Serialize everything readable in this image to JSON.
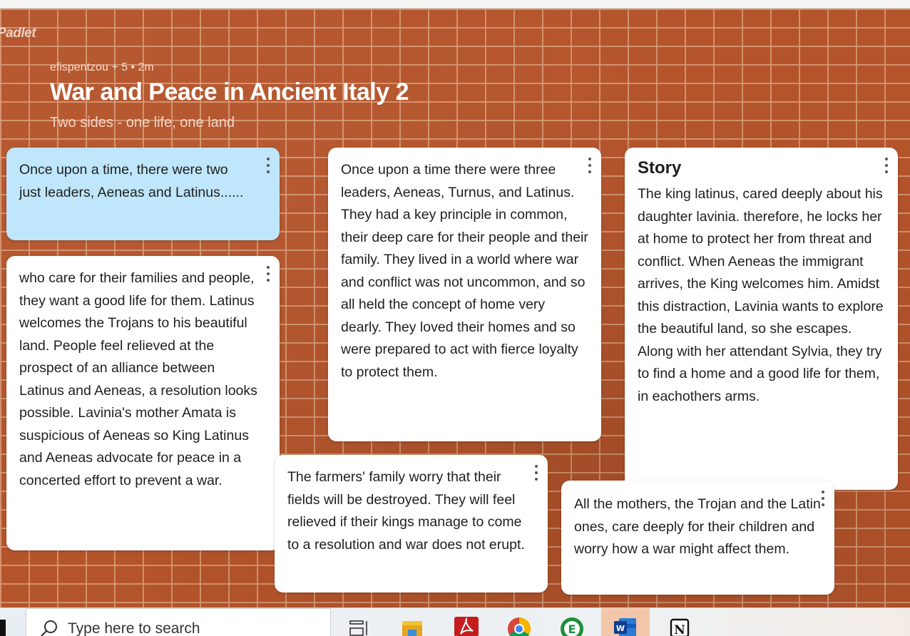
{
  "app": {
    "logo": "Padlet"
  },
  "board": {
    "meta": "efispentzou + 5 • 2m",
    "title": "War and Peace in Ancient Italy 2",
    "subtitle": "Two sides - one life, one land"
  },
  "cards": [
    {
      "heading": "",
      "body": "Once upon a time, there were two just leaders, Aeneas and Latinus......"
    },
    {
      "heading": "",
      "body": "who care for their families and people, they want a good life for them. Latinus welcomes the Trojans to his beautiful land. People feel relieved at the prospect of an alliance between Latinus and Aeneas, a resolution looks possible. Lavinia's mother Amata is suspicious of Aeneas so King Latinus and Aeneas advocate for peace in a concerted effort to prevent a war."
    },
    {
      "heading": "",
      "body": "Once upon a time there were three leaders, Aeneas, Turnus, and Latinus. They had a key principle in common, their deep care for their people and their family. They lived in a world where war and conflict was not uncommon, and so all held the concept of home very dearly. They loved their homes and so were prepared to act with fierce loyalty to protect them."
    },
    {
      "heading": "",
      "body": "The farmers' family worry that their fields will be destroyed. They will feel relieved if their kings manage to come to a resolution and war does not erupt."
    },
    {
      "heading": "Story",
      "body": "The king latinus, cared deeply about his daughter lavinia. therefore, he locks her at home to protect her from threat and conflict. When Aeneas the immigrant arrives, the King welcomes him. Amidst this distraction, Lavinia wants to explore the beautiful land, so she escapes. Along with her attendant Sylvia, they try to find a home and a good life for them, in eachothers arms."
    },
    {
      "heading": "",
      "body": "All the mothers, the Trojan and the Latin ones, care deeply for their children and worry how a war might affect them."
    }
  ],
  "taskbar": {
    "search_placeholder": "Type here to search",
    "icons": [
      "task-view-icon",
      "file-explorer-icon",
      "acrobat-icon",
      "chrome-icon",
      "evernote-icon",
      "word-icon",
      "notion-icon"
    ]
  },
  "colors": {
    "wall": "#b4542b",
    "card_blue": "#bfe6fb",
    "card_white": "#ffffff"
  }
}
